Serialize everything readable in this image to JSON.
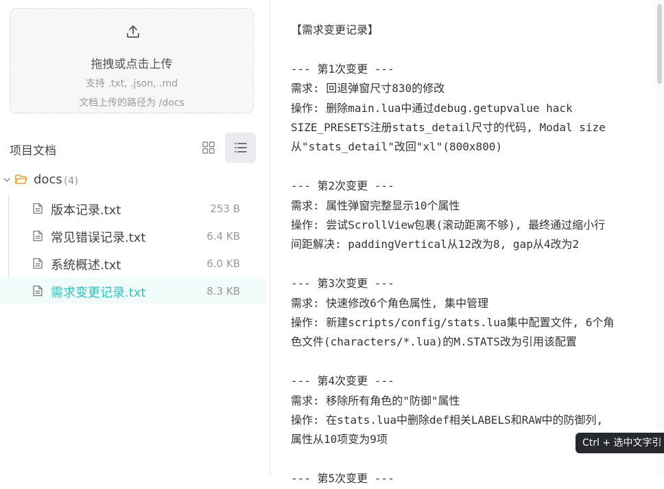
{
  "upload": {
    "title": "拖拽或点击上传",
    "hint": "支持 .txt, .json, .md",
    "path": "文档上传的路径为 /docs"
  },
  "project": {
    "title": "项目文档"
  },
  "folder": {
    "name": "docs",
    "count": "(4)"
  },
  "files": [
    {
      "name": "版本记录.txt",
      "size": "253 B"
    },
    {
      "name": "常见错误记录.txt",
      "size": "6.4 KB"
    },
    {
      "name": "系统概述.txt",
      "size": "6.0 KB"
    },
    {
      "name": "需求变更记录.txt",
      "size": "8.3 KB"
    }
  ],
  "content": {
    "lines": [
      "【需求变更记录】",
      "",
      "--- 第1次变更 ---",
      "需求: 回退弹窗尺寸830的修改",
      "操作: 删除main.lua中通过debug.getupvalue hack",
      "SIZE_PRESETS注册stats_detail尺寸的代码, Modal size",
      "从\"stats_detail\"改回\"xl\"(800x800)",
      "",
      "--- 第2次变更 ---",
      "需求: 属性弹窗完整显示10个属性",
      "操作: 尝试ScrollView包裹(滚动距离不够), 最终通过缩小行",
      "间距解决: paddingVertical从12改为8, gap从4改为2",
      "",
      "--- 第3次变更 ---",
      "需求: 快速修改6个角色属性, 集中管理",
      "操作: 新建scripts/config/stats.lua集中配置文件, 6个角",
      "色文件(characters/*.lua)的M.STATS改为引用该配置",
      "",
      "--- 第4次变更 ---",
      "需求: 移除所有角色的\"防御\"属性",
      "操作: 在stats.lua中删除def相关LABELS和RAW中的防御列,",
      "属性从10项变为9项",
      "",
      "--- 第5次变更 ---"
    ]
  },
  "tooltip": {
    "text": "Ctrl + 选中文字引"
  },
  "colors": {
    "accent": "#2fc7bb",
    "folder": "#f0a020"
  }
}
